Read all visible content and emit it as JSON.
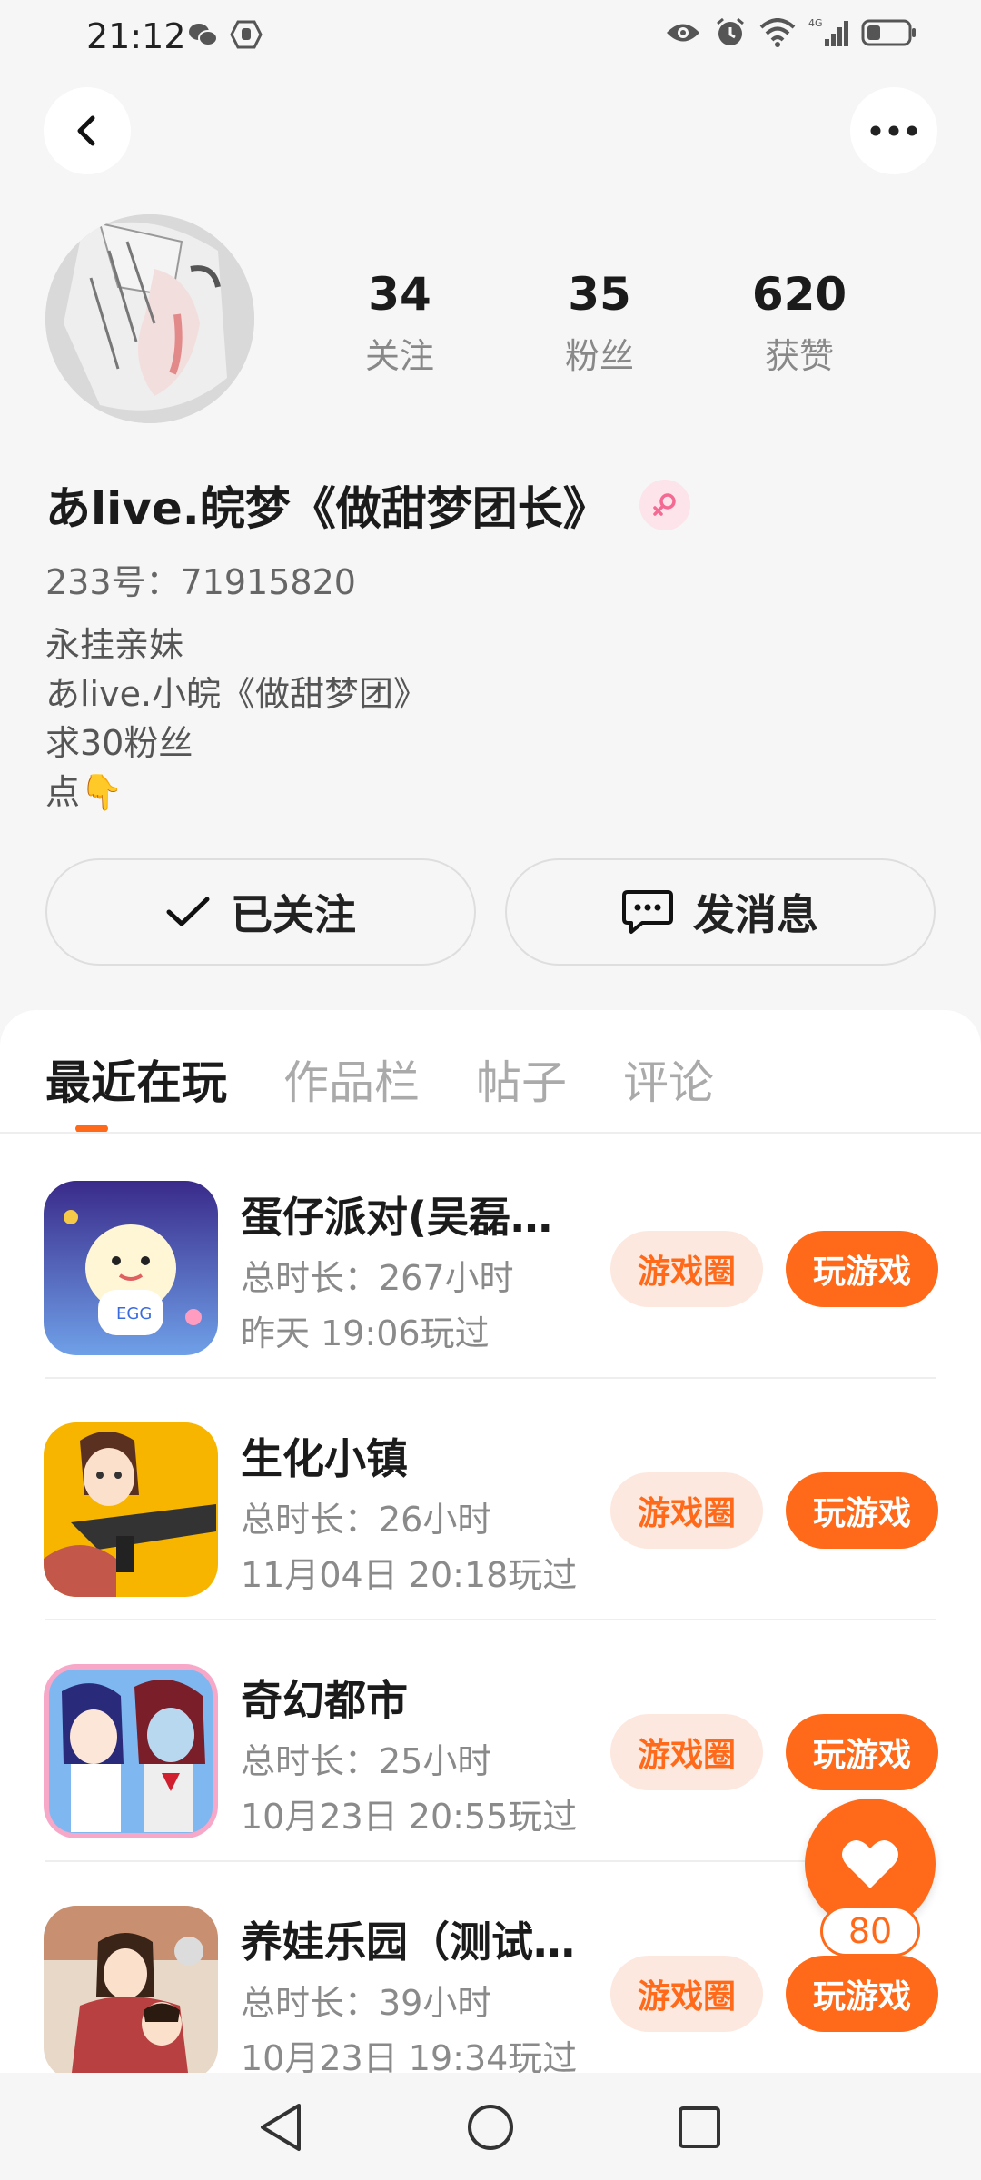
{
  "status_bar": {
    "time": "21:12",
    "network": "4G"
  },
  "profile": {
    "stats": [
      {
        "value": "34",
        "label": "关注"
      },
      {
        "value": "35",
        "label": "粉丝"
      },
      {
        "value": "620",
        "label": "获赞"
      }
    ],
    "nickname": "あlive.皖梦《做甜梦团长》",
    "account_id": "233号：71915820",
    "bio_lines": [
      "永挂亲妹",
      "あlive.小皖《做甜梦团》",
      "求30粉丝",
      "点👇"
    ]
  },
  "actions": {
    "follow_label": "已关注",
    "message_label": "发消息"
  },
  "tabs": [
    {
      "label": "最近在玩"
    },
    {
      "label": "作品栏"
    },
    {
      "label": "帖子"
    },
    {
      "label": "评论"
    }
  ],
  "games": [
    {
      "title": "蛋仔派对(吴磊…",
      "duration": "总时长：267小时",
      "last_played": "昨天 19:06玩过",
      "circle_label": "游戏圈",
      "play_label": "玩游戏"
    },
    {
      "title": "生化小镇",
      "duration": "总时长：26小时",
      "last_played": "11月04日 20:18玩过",
      "circle_label": "游戏圈",
      "play_label": "玩游戏"
    },
    {
      "title": "奇幻都市",
      "duration": "总时长：25小时",
      "last_played": "10月23日 20:55玩过",
      "circle_label": "游戏圈",
      "play_label": "玩游戏"
    },
    {
      "title": "养娃乐园（测试…",
      "duration": "总时长：39小时",
      "last_played": "10月23日 19:34玩过",
      "circle_label": "游戏圈",
      "play_label": "玩游戏"
    }
  ],
  "like_fab": {
    "count": "80"
  },
  "colors": {
    "accent": "#ff6a1a",
    "accent_light": "#fde8df",
    "background": "#f6f6f6"
  }
}
